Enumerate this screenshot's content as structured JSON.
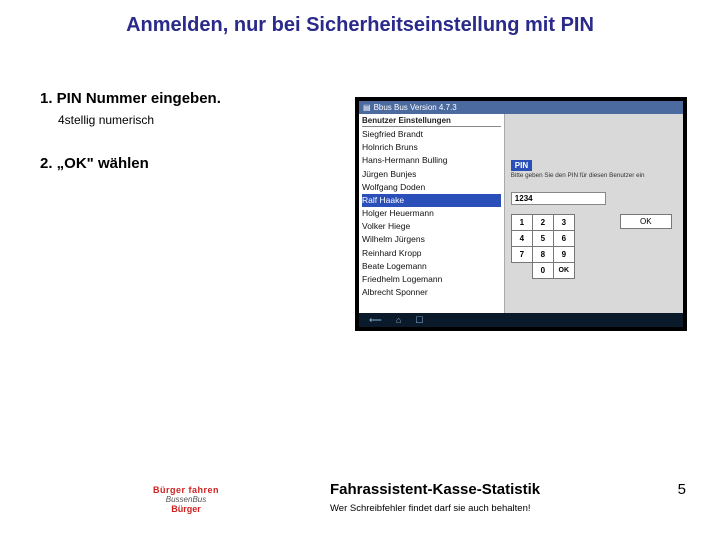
{
  "title": "Anmelden, nur bei Sicherheitseinstellung mit PIN",
  "steps": {
    "s1": "1.  PIN Nummer eingeben.",
    "s1sub": "4stellig numerisch",
    "s2": "2. „OK\" wählen"
  },
  "tablet": {
    "app_title": "Bbus Bus Version 4.7.3",
    "list_header": "Benutzer Einstellungen",
    "users": [
      "Siegfried Brandt",
      "Holnrich Bruns",
      "Hans-Hermann Bulling",
      "Jürgen Bunjes",
      "Wolfgang Doden",
      "Ralf Haake",
      "Holger Heuermann",
      "Volker Hiege",
      "Wilhelm Jürgens",
      "Reinhard Kropp",
      "Beate Logemann",
      "Friedhelm Logemann",
      "Albrecht Sponner"
    ],
    "selected_index": 5,
    "pin_label": "PIN",
    "pin_msg": "Bitte geben Sie den PIN für diesen Benutzer ein",
    "pin_value": "1234",
    "keypad": {
      "r0": [
        "1",
        "2",
        "3"
      ],
      "r1": [
        "4",
        "5",
        "6"
      ],
      "r2": [
        "7",
        "8",
        "9"
      ],
      "r3": [
        "",
        "0",
        "OK"
      ]
    },
    "big_ok": "OK"
  },
  "logo": {
    "top": "Bürger fahren",
    "mid": "BussenBus",
    "bot": "Bürger"
  },
  "footer": {
    "title": "Fahrassistent-Kasse-Statistik",
    "sub": "Wer Schreibfehler findet darf sie auch behalten!"
  },
  "page": "5"
}
